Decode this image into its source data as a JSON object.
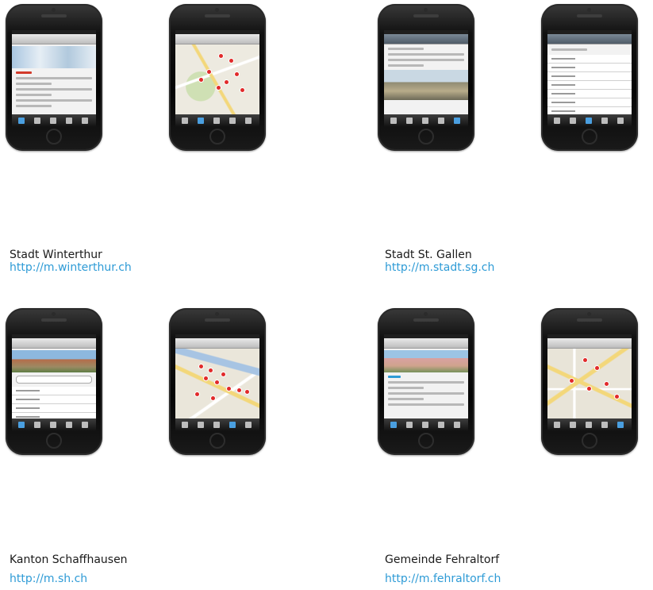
{
  "entries": [
    {
      "name": "Stadt Winterthur",
      "url": "http://m.winterthur.ch"
    },
    {
      "name": "Stadt St. Gallen",
      "url": "http://m.stadt.sg.ch"
    },
    {
      "name": "Kanton Schaffhausen",
      "url": "http://m.sh.ch"
    },
    {
      "name": "Gemeinde Fehraltorf",
      "url": "http://m.fehraltorf.ch"
    }
  ],
  "colors": {
    "link": "#2e9bd6",
    "caption": "#1a1a1a",
    "map_pin": "#e12a2a"
  },
  "icons": [
    "phone-mockup",
    "map-pin-icon",
    "tab-bar-icon"
  ]
}
